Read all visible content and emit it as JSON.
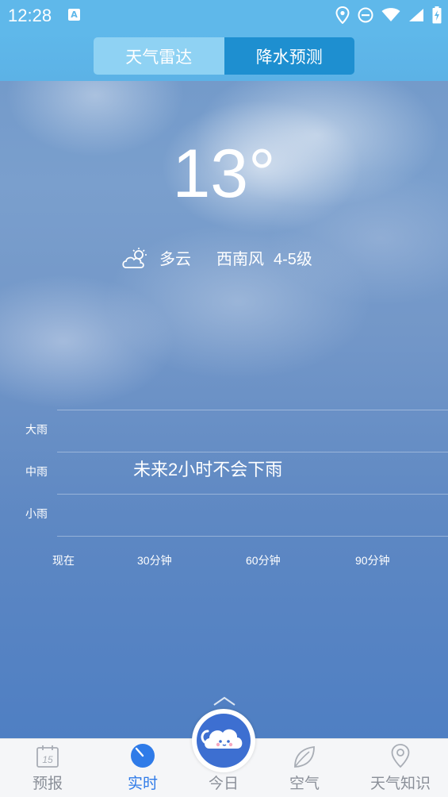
{
  "status_bar": {
    "time": "12:28",
    "badge": "A"
  },
  "segments": [
    {
      "label": "天气雷达",
      "active": false
    },
    {
      "label": "降水预测",
      "active": true
    }
  ],
  "current": {
    "temperature": "13°",
    "condition": "多云",
    "wind_direction": "西南风",
    "wind_level": "4-5级",
    "condition_icon": "partly-cloudy-icon"
  },
  "precip_chart": {
    "y_labels": [
      "大雨",
      "中雨",
      "小雨"
    ],
    "x_labels": [
      "现在",
      "30分钟",
      "60分钟",
      "90分钟"
    ],
    "message": "未来2小时不会下雨"
  },
  "tabbar": {
    "items": [
      {
        "label": "预报",
        "icon": "calendar-15-icon",
        "active": false
      },
      {
        "label": "实时",
        "icon": "clock-dial-icon",
        "active": true
      },
      {
        "label": "今日",
        "icon": "cloud-mascot-icon",
        "active": false
      },
      {
        "label": "空气",
        "icon": "leaf-icon",
        "active": false
      },
      {
        "label": "天气知识",
        "icon": "location-pin-icon",
        "active": false
      }
    ]
  },
  "colors": {
    "status_bar": "#5fb8ea",
    "segment_active": "#1e8fd0",
    "segment_inactive": "#8fd2f3",
    "tab_active": "#2f7be8",
    "tab_inactive": "#8a8f98"
  }
}
